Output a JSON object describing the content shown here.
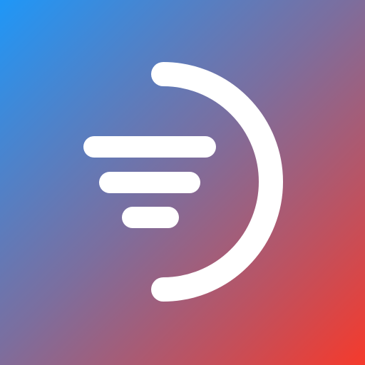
{
  "icon": {
    "name": "filter-arc-logo-icon",
    "colors": {
      "gradient_start": "#1f97f7",
      "gradient_mid": "#7c6e9e",
      "gradient_end": "#f53a2c",
      "glyph": "#ffffff"
    }
  }
}
